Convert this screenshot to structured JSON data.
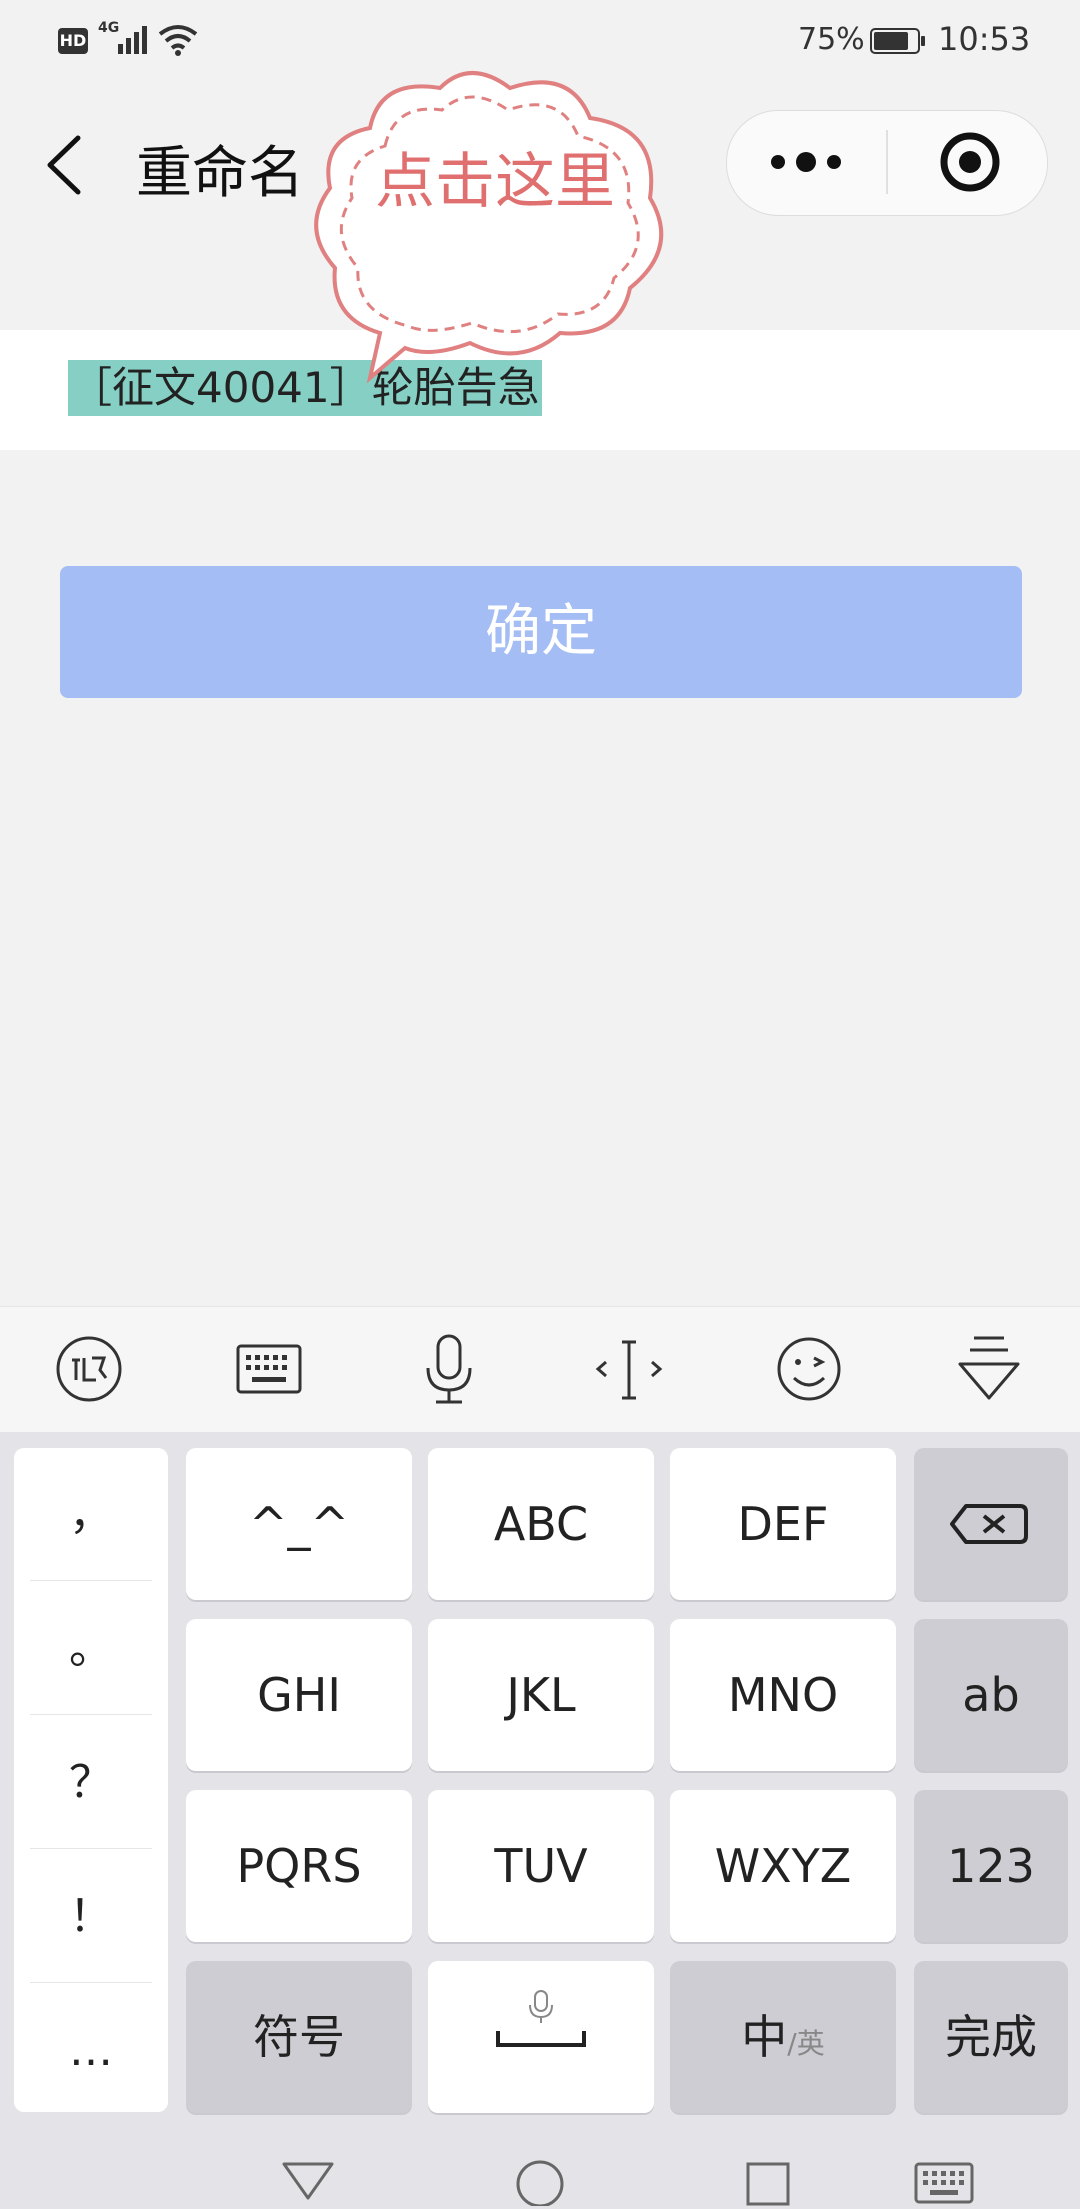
{
  "status_bar": {
    "hd": "HD",
    "network": "4G",
    "battery_percent": "75%",
    "time": "10:53"
  },
  "nav": {
    "title": "重命名",
    "icons": {
      "back": "chevron-left-icon",
      "more": "more-dots-icon",
      "target": "target-icon"
    }
  },
  "callout": {
    "text": "点击这里"
  },
  "rename": {
    "value": "［征文40041］轮胎告急"
  },
  "confirm": {
    "label": "确定",
    "color": "#a4bdf4"
  },
  "keyboard": {
    "toolbar_icons": [
      "xunfei-logo-icon",
      "keyboard-icon",
      "microphone-icon",
      "cursor-icon",
      "emoji-icon",
      "collapse-keyboard-icon"
    ],
    "punctuation": [
      "，",
      "。",
      "？",
      "！",
      "…"
    ],
    "rows": [
      [
        "^_^",
        "ABC",
        "DEF"
      ],
      [
        "GHI",
        "JKL",
        "MNO"
      ],
      [
        "PQRS",
        "TUV",
        "WXYZ"
      ]
    ],
    "fn_keys": {
      "ab": "ab",
      "num": "123",
      "symbols": "符号",
      "lang_main": "中",
      "lang_sub": "/英",
      "done": "完成"
    }
  },
  "system_nav": [
    "back-icon",
    "home-icon",
    "recents-icon",
    "keyboard-switch-icon"
  ],
  "colors": {
    "selection": "#86cfc4",
    "callout": "#e07070"
  }
}
